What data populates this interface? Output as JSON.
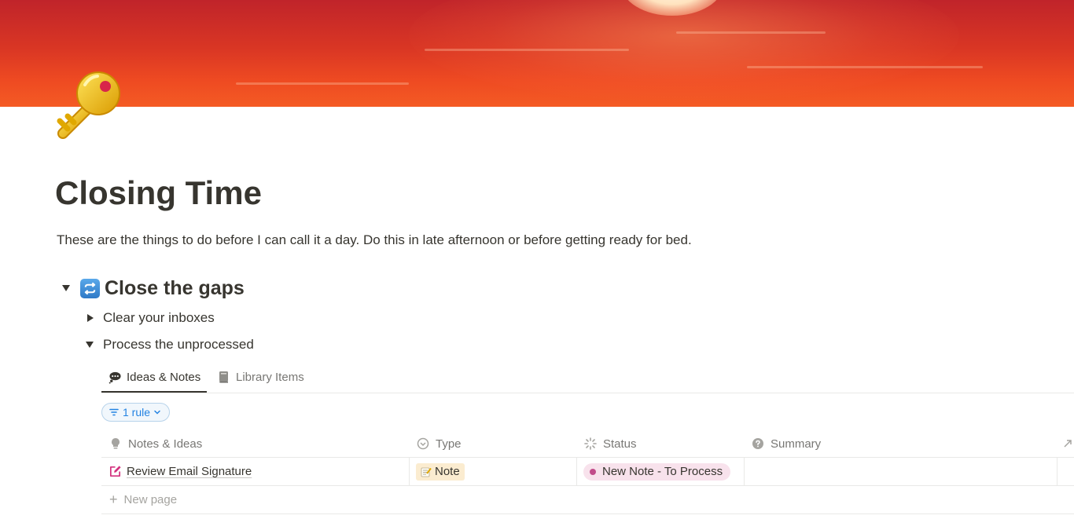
{
  "page": {
    "title": "Closing Time",
    "description": "These are the things to do before I can call it a day. Do this in late afternoon or before getting ready for bed.",
    "icon": "old-key-icon",
    "cover": "red-sunset-cover"
  },
  "section": {
    "heading": "Close the gaps",
    "heading_icon": "repeat-arrows-icon",
    "toggles": [
      {
        "label": "Clear your inboxes",
        "expanded": false
      },
      {
        "label": "Process the unprocessed",
        "expanded": true
      }
    ]
  },
  "database": {
    "tabs": [
      {
        "label": "Ideas & Notes",
        "icon": "thought-bubble-icon",
        "active": true
      },
      {
        "label": "Library Items",
        "icon": "book-icon",
        "active": false
      }
    ],
    "filter": {
      "label": "1 rule"
    },
    "columns": [
      {
        "label": "Notes & Ideas",
        "icon": "lightbulb-icon"
      },
      {
        "label": "Type",
        "icon": "select-circle-icon"
      },
      {
        "label": "Status",
        "icon": "status-spinner-icon"
      },
      {
        "label": "Summary",
        "icon": "question-circle-icon"
      }
    ],
    "rows": [
      {
        "title": "Review Email Signature",
        "icon": "edit-pencil-icon",
        "type": "Note",
        "type_icon": "memo-icon",
        "status": "New Note - To Process",
        "summary": ""
      }
    ],
    "new_page": "New page"
  },
  "colors": {
    "status_pink": "#f8e2ec",
    "status_dot": "#c14c8a",
    "type_yellow": "#fbecd0",
    "filter_blue": "#2383e2",
    "edit_icon": "#d3317e"
  }
}
